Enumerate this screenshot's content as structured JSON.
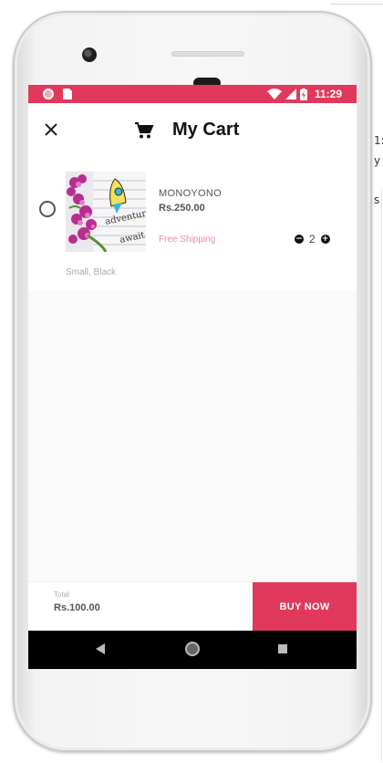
{
  "background_page": {
    "fragments": [
      "1:",
      "y",
      "s"
    ]
  },
  "status_bar": {
    "time": "11:29",
    "color": "#e0395c"
  },
  "app_bar": {
    "title": "My Cart",
    "close_icon": "close-icon",
    "cart_icon": "shopping-cart-icon"
  },
  "cart_item": {
    "name": "MONOYONO",
    "price": "Rs.250.00",
    "shipping": "Free Shipping",
    "quantity": "2",
    "variant": "Small, Black",
    "decrease_icon": "minus-circle-icon",
    "increase_icon": "plus-circle-icon"
  },
  "footer": {
    "total_label": "Total",
    "total_value": "Rs.100.00",
    "buy_label": "BUY NOW",
    "accent": "#e0395c"
  },
  "nav_bar": {
    "back_icon": "back-triangle-icon",
    "home_icon": "home-circle-icon",
    "recents_icon": "recents-square-icon"
  }
}
